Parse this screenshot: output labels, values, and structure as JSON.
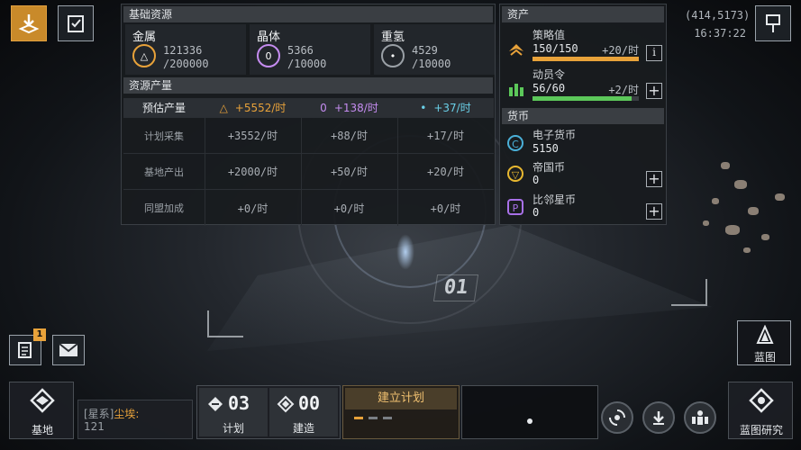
{
  "topbar": {
    "coords": "(414,5173)",
    "time": "16:37:22"
  },
  "base_resources": {
    "title": "基础资源",
    "items": [
      {
        "name": "金属",
        "current": "121336",
        "max": "/200000",
        "icon": "metal-icon",
        "color": "#e8a23a",
        "glyph": "△"
      },
      {
        "name": "晶体",
        "current": "5366",
        "max": "/10000",
        "icon": "crystal-icon",
        "color": "#c58cf0",
        "glyph": "0"
      },
      {
        "name": "重氢",
        "current": "4529",
        "max": "/10000",
        "icon": "deuterium-icon",
        "color": "#6ad0e8",
        "glyph": "•"
      }
    ]
  },
  "production": {
    "title": "资源产量",
    "header_label": "预估产量",
    "header_values": [
      "+5552/时",
      "+138/时",
      "+37/时"
    ],
    "header_glyphs": [
      "△",
      "0",
      "•"
    ],
    "rows": [
      {
        "label": "计划采集",
        "values": [
          "+3552/时",
          "+88/时",
          "+17/时"
        ]
      },
      {
        "label": "基地产出",
        "values": [
          "+2000/时",
          "+50/时",
          "+20/时"
        ]
      },
      {
        "label": "同盟加成",
        "values": [
          "+0/时",
          "+0/时",
          "+0/时"
        ]
      }
    ]
  },
  "assets": {
    "title": "资产",
    "strategy": {
      "name": "策略值",
      "value": "150/150",
      "rate": "+20/时",
      "fill": 1.0,
      "color": "#e8a23a",
      "info_label": "i"
    },
    "mobilize": {
      "name": "动员令",
      "value": "56/60",
      "rate": "+2/时",
      "fill": 0.933,
      "color": "#5cc85a",
      "plus_label": "+"
    }
  },
  "currency": {
    "title": "货币",
    "items": [
      {
        "name": "电子货币",
        "value": "5150",
        "icon": "e-currency-icon",
        "color": "#4ab0d8",
        "glyph": "C",
        "has_plus": false
      },
      {
        "name": "帝国币",
        "value": "0",
        "icon": "empire-coin-icon",
        "color": "#e8b830",
        "glyph": "▽",
        "has_plus": true
      },
      {
        "name": "比邻星币",
        "value": "0",
        "icon": "proxima-coin-icon",
        "color": "#a870e8",
        "glyph": "P",
        "has_plus": true
      }
    ],
    "plus_label": "+"
  },
  "map": {
    "grid_code": "01"
  },
  "left_side": {
    "notes_badge": "1"
  },
  "blueprint_btn": {
    "label": "蓝图"
  },
  "bottom": {
    "base_label": "基地",
    "location_prefix": "[星系]",
    "location_name": "尘埃:",
    "location_value": "121",
    "plan_count": "03",
    "plan_label": "计划",
    "build_count": "00",
    "build_label": "建造",
    "create_plan": "建立计划",
    "research_label": "蓝图研究"
  }
}
